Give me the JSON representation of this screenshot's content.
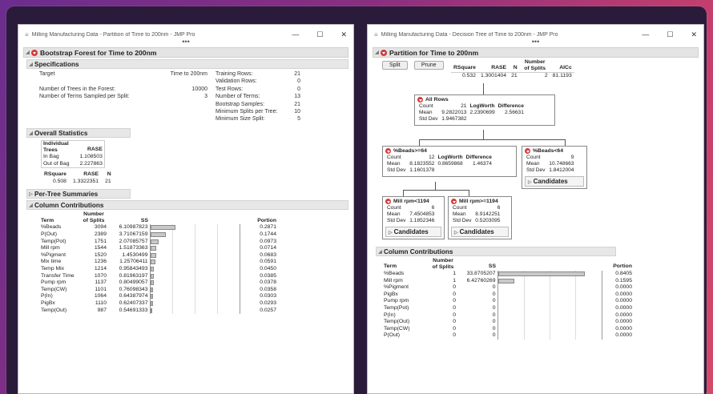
{
  "window1": {
    "title": "Milling Manufacturing Data - Partition of Time to 200nm - JMP Pro",
    "report_title": "Bootstrap Forest for Time to 200nm",
    "specifications": {
      "header": "Specifications",
      "left_rows": [
        {
          "label": "Target",
          "value": "Time to 200nm"
        },
        {
          "label": "",
          "value": ""
        },
        {
          "label": "Number of Trees in the Forest:",
          "value": "10000"
        },
        {
          "label": "Number of Terms Sampled per Split:",
          "value": "3"
        }
      ],
      "right_rows": [
        {
          "label": "Training Rows:",
          "value": "21"
        },
        {
          "label": "Validation Rows:",
          "value": "0"
        },
        {
          "label": "Test Rows:",
          "value": "0"
        },
        {
          "label": "Number of Terms:",
          "value": "13"
        },
        {
          "label": "Bootstrap Samples:",
          "value": "21"
        },
        {
          "label": "Minimum Splits per Tree:",
          "value": "10"
        },
        {
          "label": "Minimum Size Split:",
          "value": "5"
        }
      ]
    },
    "overall": {
      "header": "Overall Statistics",
      "col1": "Individual Trees",
      "col2": "RASE",
      "rows": [
        {
          "label": "In Bag",
          "value": "1.108503"
        },
        {
          "label": "Out of Bag",
          "value": "2.227863"
        }
      ],
      "rsq_headers": [
        "RSquare",
        "RASE",
        "N"
      ],
      "rsq_values": [
        "0.508",
        "1.3322351",
        "21"
      ]
    },
    "per_tree": "Per-Tree Summaries",
    "contrib": {
      "header": "Column Contributions",
      "headers": [
        "Term",
        "Number of Splits",
        "SS",
        "Portion"
      ],
      "rows": [
        {
          "term": "%Beads",
          "splits": "3094",
          "ss": "6.10987823",
          "portion": "0.2871",
          "frac": 0.2871
        },
        {
          "term": "P(Out)",
          "splits": "2389",
          "ss": "3.71067159",
          "portion": "0.1744",
          "frac": 0.1744
        },
        {
          "term": "Temp(Pot)",
          "splits": "1751",
          "ss": "2.07085757",
          "portion": "0.0973",
          "frac": 0.0973
        },
        {
          "term": "Mill rpm",
          "splits": "1544",
          "ss": "1.51873363",
          "portion": "0.0714",
          "frac": 0.0714
        },
        {
          "term": "%Pigment",
          "splits": "1520",
          "ss": "1.4530499",
          "portion": "0.0683",
          "frac": 0.0683
        },
        {
          "term": "Mix time",
          "splits": "1236",
          "ss": "1.25706411",
          "portion": "0.0591",
          "frac": 0.0591
        },
        {
          "term": "Temp Mix",
          "splits": "1214",
          "ss": "0.95843493",
          "portion": "0.0450",
          "frac": 0.045
        },
        {
          "term": "Transfer Time",
          "splits": "1070",
          "ss": "0.81963197",
          "portion": "0.0385",
          "frac": 0.0385
        },
        {
          "term": "Pump rpm",
          "splits": "1137",
          "ss": "0.80499057",
          "portion": "0.0378",
          "frac": 0.0378
        },
        {
          "term": "Temp(CW)",
          "splits": "1101",
          "ss": "0.76098343",
          "portion": "0.0358",
          "frac": 0.0358
        },
        {
          "term": "P(In)",
          "splits": "1064",
          "ss": "0.64387974",
          "portion": "0.0303",
          "frac": 0.0303
        },
        {
          "term": "PigBx",
          "splits": "1110",
          "ss": "0.62407337",
          "portion": "0.0293",
          "frac": 0.0293
        },
        {
          "term": "Temp(Out)",
          "splits": "987",
          "ss": "0.54691333",
          "portion": "0.0257",
          "frac": 0.0257
        }
      ]
    }
  },
  "window2": {
    "title": "Milling Manufacturing Data - Decision Tree of Time to 200nm - JMP Pro",
    "report_title": "Partition for Time to 200nm",
    "split_label": "Split",
    "prune_label": "Prune",
    "summary_headers": [
      "RSquare",
      "RASE",
      "N",
      "Number of Splits",
      "AICc"
    ],
    "summary_values": [
      "0.532",
      "1.3001404",
      "21",
      "2",
      "81.1193"
    ],
    "nodes": {
      "all": {
        "title": "All Rows",
        "count": "21",
        "mean": "9.2822013",
        "std": "1.9467382",
        "logworth": "2.2390699",
        "diff": "2.56631"
      },
      "beads_ge": {
        "title": "%Beads>=64",
        "count": "12",
        "mean": "8.1823552",
        "std": "1.1601378",
        "logworth": "0.8659868",
        "diff": "1.46374"
      },
      "beads_lt": {
        "title": "%Beads<64",
        "count": "9",
        "mean": "10.748663",
        "std": "1.8412004"
      },
      "mill_lt": {
        "title": "Mill rpm<1194",
        "count": "6",
        "mean": "7.4504853",
        "std": "1.1852346"
      },
      "mill_ge": {
        "title": "Mill rpm>=1194",
        "count": "6",
        "mean": "8.9142251",
        "std": "0.5203095"
      }
    },
    "labels": {
      "count": "Count",
      "mean": "Mean",
      "std": "Std Dev",
      "logworth": "LogWorth",
      "difference": "Difference",
      "candidates": "Candidates"
    },
    "contrib": {
      "header": "Column Contributions",
      "headers": [
        "Term",
        "Number of Splits",
        "SS",
        "Portion"
      ],
      "rows": [
        {
          "term": "%Beads",
          "splits": "1",
          "ss": "33.8705207",
          "portion": "0.8405",
          "frac": 0.8405
        },
        {
          "term": "Mill rpm",
          "splits": "1",
          "ss": "6.42760269",
          "portion": "0.1595",
          "frac": 0.1595
        },
        {
          "term": "%Pigment",
          "splits": "0",
          "ss": "0",
          "portion": "0.0000",
          "frac": 0
        },
        {
          "term": "PigBx",
          "splits": "0",
          "ss": "0",
          "portion": "0.0000",
          "frac": 0
        },
        {
          "term": "Pump rpm",
          "splits": "0",
          "ss": "0",
          "portion": "0.0000",
          "frac": 0
        },
        {
          "term": "Temp(Pot)",
          "splits": "0",
          "ss": "0",
          "portion": "0.0000",
          "frac": 0
        },
        {
          "term": "P(In)",
          "splits": "0",
          "ss": "0",
          "portion": "0.0000",
          "frac": 0
        },
        {
          "term": "Temp(Out)",
          "splits": "0",
          "ss": "0",
          "portion": "0.0000",
          "frac": 0
        },
        {
          "term": "Temp(CW)",
          "splits": "0",
          "ss": "0",
          "portion": "0.0000",
          "frac": 0
        },
        {
          "term": "P(Out)",
          "splits": "0",
          "ss": "0",
          "portion": "0.0000",
          "frac": 0
        }
      ]
    }
  },
  "window_controls": {
    "minimize": "—",
    "maximize": "☐",
    "close": "✕"
  }
}
